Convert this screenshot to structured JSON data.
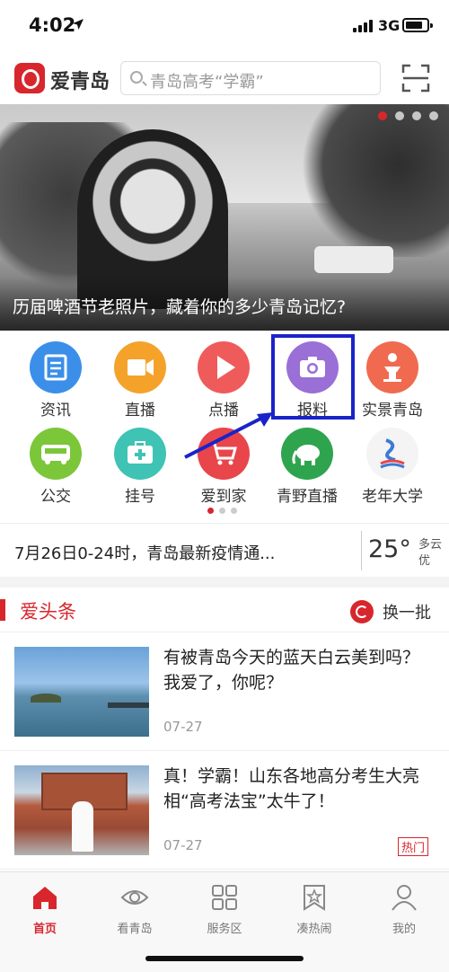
{
  "status_bar": {
    "time": "4:02",
    "network": "3G"
  },
  "header": {
    "brand": "爱青岛",
    "search_placeholder": "青岛高考“学霸”"
  },
  "banner": {
    "caption": "历届啤酒节老照片，藏着你的多少青岛记忆?",
    "slide_count": 4,
    "active_slide": 1
  },
  "services": [
    {
      "label": "资讯",
      "icon": "news-icon",
      "color": "#3b8fe8"
    },
    {
      "label": "直播",
      "icon": "video-camera-icon",
      "color": "#f5a22b"
    },
    {
      "label": "点播",
      "icon": "play-icon",
      "color": "#ef5b5b"
    },
    {
      "label": "报料",
      "icon": "camera-icon",
      "color": "#9a6fd6"
    },
    {
      "label": "实景青岛",
      "icon": "landmark-icon",
      "color": "#f06a50"
    },
    {
      "label": "公交",
      "icon": "bus-icon",
      "color": "#7cc63a"
    },
    {
      "label": "挂号",
      "icon": "medical-kit-icon",
      "color": "#3ec3b4"
    },
    {
      "label": "爱到家",
      "icon": "shopping-cart-icon",
      "color": "#e8464a"
    },
    {
      "label": "青野直播",
      "icon": "elephant-icon",
      "color": "#2fa44f"
    },
    {
      "label": "老年大学",
      "icon": "university-logo-icon",
      "color": "#3a7bd5"
    }
  ],
  "service_pages": {
    "count": 3,
    "active": 1
  },
  "annotation": {
    "highlight_color": "#1a23c9",
    "target": "报料"
  },
  "ticker": {
    "text": "7月26日0-24时，青岛最新疫情通...",
    "temperature": "25°",
    "weather": "多云",
    "air_quality": "优"
  },
  "section": {
    "title": "爱头条",
    "refresh_label": "换一批"
  },
  "news": [
    {
      "headline": "有被青岛今天的蓝天白云美到吗？我爱了，你呢？",
      "date": "07-27",
      "tag": ""
    },
    {
      "headline": "真！学霸！山东各地高分考生大亮相“高考法宝”太牛了！",
      "date": "07-27",
      "tag": "热门"
    }
  ],
  "tabs": [
    {
      "label": "首页",
      "icon": "home-icon",
      "active": true
    },
    {
      "label": "看青岛",
      "icon": "eye-icon",
      "active": false
    },
    {
      "label": "服务区",
      "icon": "grid-icon",
      "active": false
    },
    {
      "label": "凑热闹",
      "icon": "star-bookmark-icon",
      "active": false
    },
    {
      "label": "我的",
      "icon": "user-icon",
      "active": false
    }
  ],
  "colors": {
    "brand_red": "#d8262d",
    "annotation_blue": "#1a23c9"
  }
}
